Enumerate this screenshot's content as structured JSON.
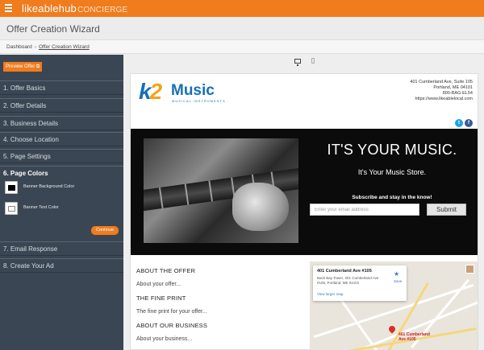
{
  "app": {
    "brand_main": "likeablehub",
    "brand_sub": "CONCIERGE",
    "page_title": "Offer Creation Wizard"
  },
  "breadcrumb": {
    "home": "Dashboard",
    "current": "Offer Creation Wizard"
  },
  "sidebar": {
    "preview_label": "Preview Offer",
    "steps": [
      {
        "label": "1. Offer Basics"
      },
      {
        "label": "2. Offer Details"
      },
      {
        "label": "3. Business Details"
      },
      {
        "label": "4. Choose Location"
      },
      {
        "label": "5. Page Settings"
      },
      {
        "label": "6. Page Colors"
      },
      {
        "label": "7. Email Response"
      },
      {
        "label": "8. Create Your Ad"
      }
    ],
    "active_step": 5,
    "colors": {
      "banner_bg_label": "Banner Background Color",
      "banner_bg_value": "#000000",
      "banner_text_label": "Banner Text Color",
      "banner_text_value": "#ffffff"
    },
    "continue_label": "Continue"
  },
  "preview": {
    "devices": [
      "monitor-icon",
      "phone-icon"
    ],
    "logo": {
      "mark_k": "k",
      "mark_2": "2",
      "word": "Music",
      "sub": "MUSICAL INSTRUMENTS"
    },
    "address": {
      "line1": "401 Cumberland Ave, Suite 105",
      "line2": "Portland, ME 04101",
      "phone": "800-BAG-EL54",
      "url": "https://www.likeablelocal.com"
    },
    "hero": {
      "headline": "IT'S YOUR MUSIC.",
      "subhead": "It's Your Music Store.",
      "cta": "Subscribe and stay in the know!",
      "email_placeholder": "Enter your email address",
      "submit_label": "Submit"
    },
    "sections": {
      "about_offer_title": "ABOUT THE OFFER",
      "about_offer_text": "About your offer...",
      "fine_print_title": "THE FINE PRINT",
      "fine_print_text": "The fine print for your offer...",
      "about_business_title": "ABOUT OUR BUSINESS",
      "about_business_text": "About your business..."
    },
    "map": {
      "card_title": "401 Cumberland Ave #105",
      "card_address": "Back Bay Tower, 401 Cumberland Ave #105, Portland, ME 04101",
      "card_link": "View larger map",
      "save_label": "Save",
      "pin_label_1": "401 Cumberland",
      "pin_label_2": "Ave #105"
    }
  },
  "colors": {
    "accent": "#f07c1e",
    "sidebar_bg": "#3b4654",
    "brand_blue": "#1570b7",
    "brand_yellow": "#f5a31b"
  }
}
